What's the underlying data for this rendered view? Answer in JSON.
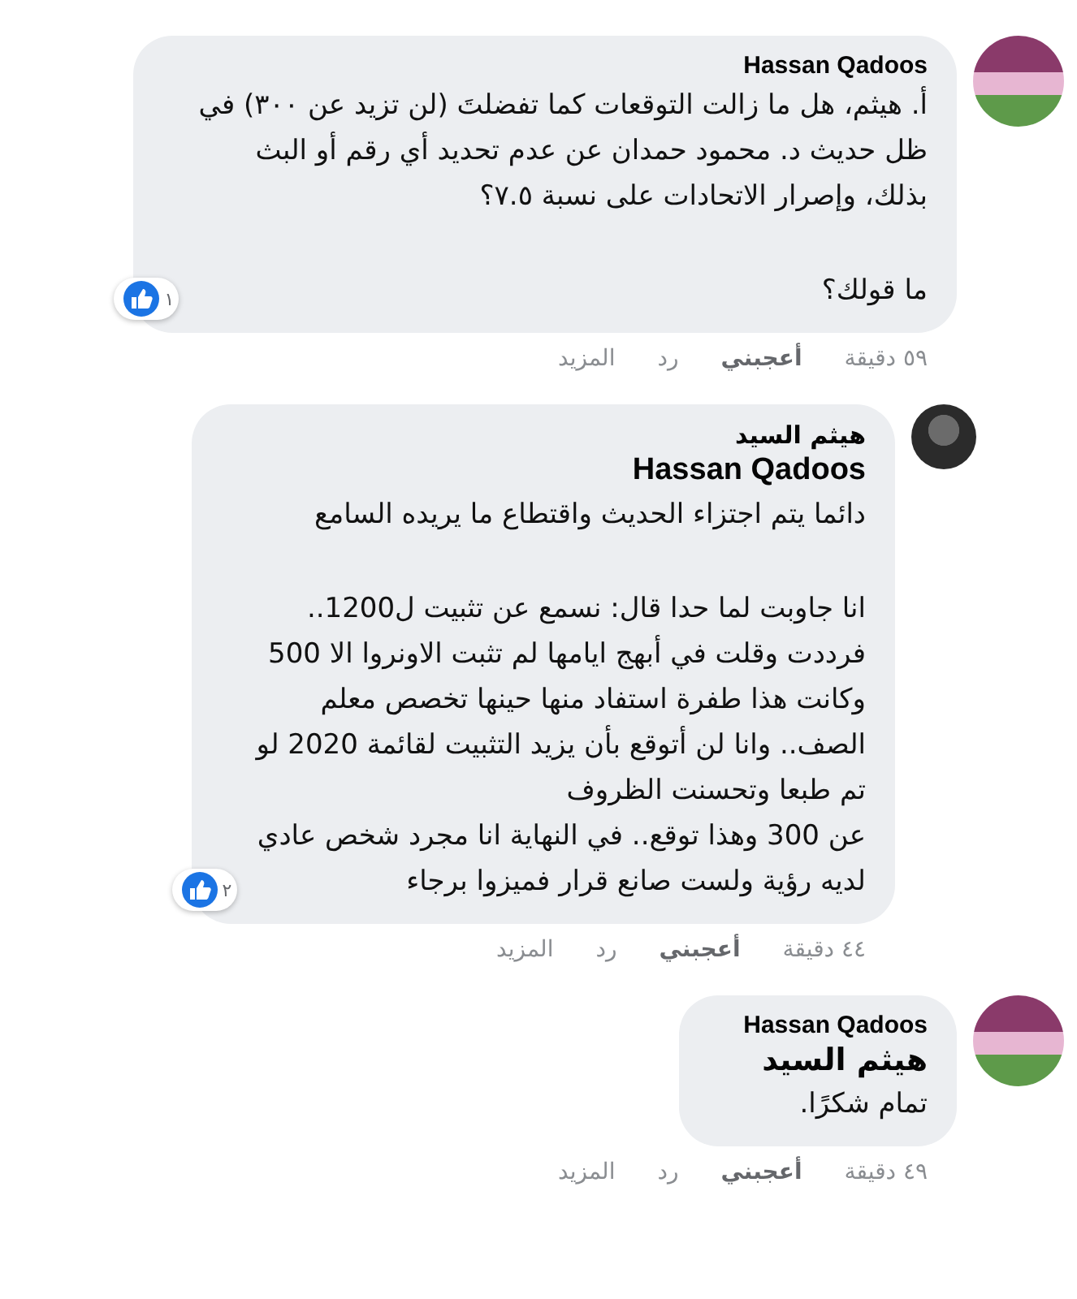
{
  "comments": [
    {
      "kind": "comment",
      "author": "Hassan Qadoos",
      "paragraphs": [
        "أ. هيثم، هل ما زالت التوقعات كما تفضلتَ (لن تزيد عن ٣٠٠) في\nظل حديث د. محمود حمدان عن عدم تحديد أي رقم أو البث\nبذلك، وإصرار الاتحادات على نسبة ٧.٥؟",
        "ما قولك؟"
      ],
      "likes": "١",
      "time": "٥٩ دقيقة",
      "like_label": "أعجبني",
      "reply_label": "رد",
      "more_label": "المزيد"
    },
    {
      "kind": "reply",
      "author": "هيثم السيد",
      "mention": "Hassan Qadoos",
      "paragraphs": [
        "دائما يتم اجتزاء الحديث واقتطاع ما يريده السامع",
        "انا جاوبت لما حدا قال: نسمع عن تثبيت ل1200..\nفرددت وقلت في أبهج ايامها لم تثبت الاونروا الا 500\nوكانت هذا طفرة استفاد منها حينها تخصص معلم\nالصف.. وانا لن أتوقع بأن يزيد التثبيت لقائمة 2020 لو\nتم طبعا وتحسنت الظروف\nعن 300 وهذا توقع.. في النهاية انا مجرد شخص عادي\nلديه رؤية ولست صانع قرار فميزوا برجاء"
      ],
      "likes": "٢",
      "time": "٤٤ دقيقة",
      "like_label": "أعجبني",
      "reply_label": "رد",
      "more_label": "المزيد"
    },
    {
      "kind": "comment",
      "author": "Hassan Qadoos",
      "mention": "هيثم السيد",
      "paragraphs": [
        "تمام شكرًا."
      ],
      "time": "٤٩ دقيقة",
      "like_label": "أعجبني",
      "reply_label": "رد",
      "more_label": "المزيد"
    }
  ]
}
